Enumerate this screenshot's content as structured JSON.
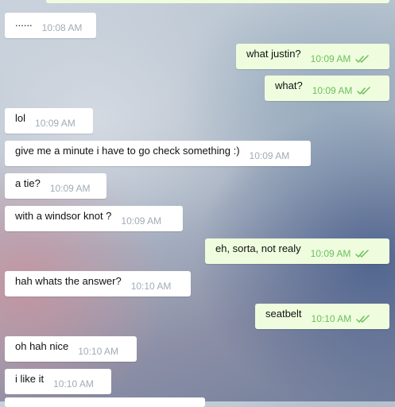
{
  "messages": [
    {
      "dir": "in",
      "text": "......",
      "time": "10:08 AM"
    },
    {
      "dir": "out",
      "text": "what justin?",
      "time": "10:09 AM"
    },
    {
      "dir": "out",
      "text": "what?",
      "time": "10:09 AM"
    },
    {
      "dir": "in",
      "text": "lol",
      "time": "10:09 AM"
    },
    {
      "dir": "in",
      "text": "give me a minute i have to go check something :)",
      "time": "10:09 AM"
    },
    {
      "dir": "in",
      "text": "a tie?",
      "time": "10:09 AM"
    },
    {
      "dir": "in",
      "text": "with a windsor knot ?",
      "time": "10:09 AM"
    },
    {
      "dir": "out",
      "text": "eh, sorta, not realy",
      "time": "10:09 AM"
    },
    {
      "dir": "in",
      "text": "hah whats the answer?",
      "time": "10:10 AM"
    },
    {
      "dir": "out",
      "text": "seatbelt",
      "time": "10:10 AM"
    },
    {
      "dir": "in",
      "text": "oh hah nice",
      "time": "10:10 AM"
    },
    {
      "dir": "in",
      "text": "i like it",
      "time": "10:10 AM"
    }
  ],
  "colors": {
    "incoming_bubble": "#ffffff",
    "outgoing_bubble": "#effdde",
    "read_check": "#6cbf5d",
    "time_incoming": "#a0acb6"
  },
  "icons": {
    "read_receipt": "double-check-icon"
  }
}
